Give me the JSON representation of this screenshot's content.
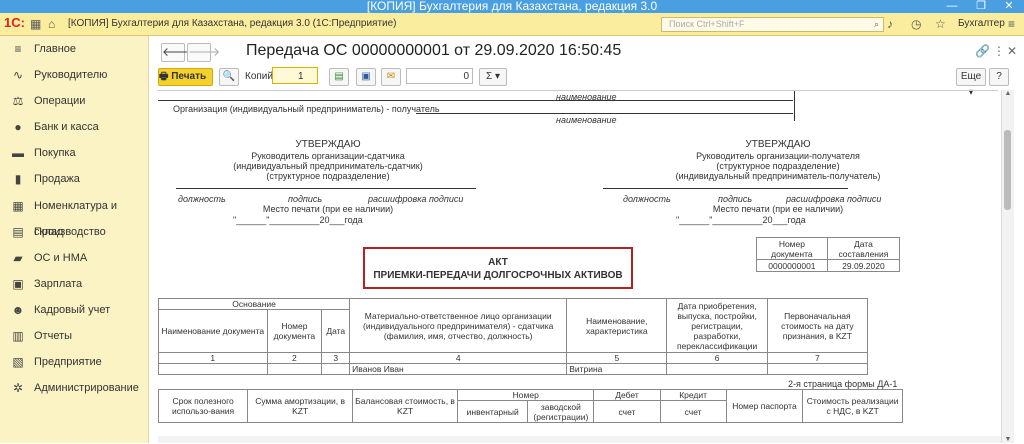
{
  "window": {
    "title": "[КОПИЯ] Бухгалтерия для Казахстана, редакция 3.0",
    "controls": [
      "—",
      "❐",
      "✕"
    ]
  },
  "appbar": {
    "logo": "1С:",
    "title": "[КОПИЯ] Бухгалтерия для Казахстана, редакция 3.0  (1С:Предприятие)",
    "search_placeholder": "Поиск Ctrl+Shift+F",
    "user": "Бухгалтер",
    "icons": [
      "grid-icon",
      "home-icon",
      "search-icon",
      "bell-icon",
      "history-icon",
      "star-icon",
      "user-icon",
      "menu-icon"
    ]
  },
  "sidebar": {
    "items": [
      {
        "label": "Главное",
        "icon": "≡"
      },
      {
        "label": "Руководителю",
        "icon": "∿"
      },
      {
        "label": "Операции",
        "icon": "⚖"
      },
      {
        "label": "Банк и касса",
        "icon": "●"
      },
      {
        "label": "Покупка",
        "icon": "▬"
      },
      {
        "label": "Продажа",
        "icon": "▮"
      },
      {
        "label": "Номенклатура и склад",
        "icon": "▦"
      },
      {
        "label": "Производство",
        "icon": "▤"
      },
      {
        "label": "ОС и НМА",
        "icon": "▰"
      },
      {
        "label": "Зарплата",
        "icon": "▣"
      },
      {
        "label": "Кадровый учет",
        "icon": "☻"
      },
      {
        "label": "Отчеты",
        "icon": "▥"
      },
      {
        "label": "Предприятие",
        "icon": "▧"
      },
      {
        "label": "Администрирование",
        "icon": "✲"
      }
    ]
  },
  "document": {
    "title": "Передача ОС 00000000001 от 29.09.2020 16:50:45",
    "print_label": "Печать",
    "copies_label": "Копий:",
    "copies_value": "1",
    "number_value": "0",
    "sum_label": "Σ",
    "more_label": "Еще",
    "help_label": "?"
  },
  "form": {
    "naimenovanie": "наименование",
    "org_receiver": "Организация (индивидуальный предприниматель) - получатель",
    "left": {
      "approve": "УТВЕРЖДАЮ",
      "line1": "Руководитель организации-сдатчика",
      "line2": "(индивидуальный предприниматель-сдатчик)",
      "line3": "(структурное подразделение)"
    },
    "right": {
      "approve": "УТВЕРЖДАЮ",
      "line1": "Руководитель организации-получателя",
      "line2": "(структурное подразделение)",
      "line3": "(индивидуальный предприниматель-получатель)"
    },
    "sig_labels": [
      "должность",
      "подпись",
      "расшифровка подписи"
    ],
    "stamp": "Место печати (при ее наличии)",
    "date_year": "20",
    "date_suffix": "года",
    "doc_number_header": "Номер документа",
    "doc_date_header": "Дата составления",
    "doc_number": "0000000001",
    "doc_date": "29.09.2020",
    "act_line1": "АКТ",
    "act_line2": "ПРИЕМКИ-ПЕРЕДАЧИ ДОЛГОСРОЧНЫХ АКТИВОВ",
    "table1": {
      "osnovanie": "Основание",
      "h_name": "Наименование документа",
      "h_num": "Номер документа",
      "h_date": "Дата",
      "h_mol": "Материально-ответственное лицо организации (индивидуального предпринимателя) - сдатчика (фамилия, имя, отчество, должность)",
      "h_char": "Наименование, характеристика",
      "h_acq": "Дата приобретения, выпуска, постройки, регистрации, разработки, переклассификации",
      "h_cost": "Первоначальная стоимость на дату признания, в KZT",
      "nums": [
        "1",
        "2",
        "3",
        "4",
        "5",
        "6",
        "7"
      ],
      "row_mol": "Иванов Иван",
      "row_char": "Витрина"
    },
    "page2": "2-я страница формы ДА-1",
    "table2": {
      "h_srok": "Срок полезного использо-вания",
      "h_amort": "Сумма амортизации, в KZT",
      "h_bal": "Балансовая стоимость, в KZT",
      "h_nomer": "Номер",
      "h_inv": "инвентарный",
      "h_zav": "заводской (регистрации)",
      "h_debet": "Дебет",
      "h_credit": "Кредит",
      "h_schet1": "счет",
      "h_schet2": "счет",
      "h_passport": "Номер паспорта",
      "h_cost_vat": "Стоимость реализации с НДС, в KZT"
    }
  }
}
